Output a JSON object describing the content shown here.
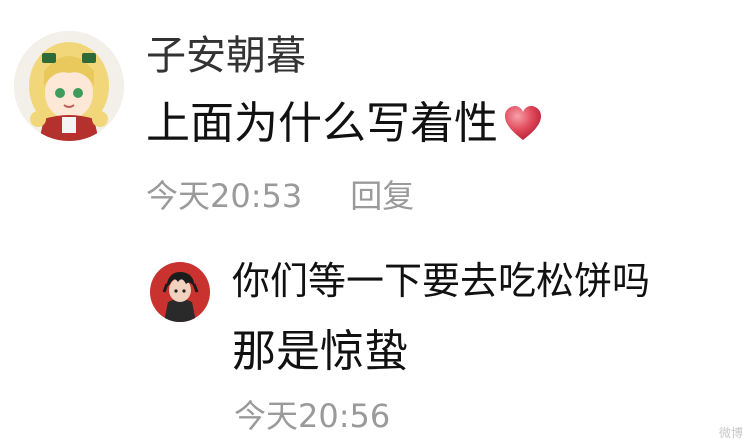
{
  "comment": {
    "username": "子安朝暮",
    "text": "上面为什么写着性",
    "emoji": "heart-icon",
    "time": "今天20:53",
    "reply_label": "回复"
  },
  "reply": {
    "username": "你们等一下要去吃松饼吗",
    "text": "那是惊蛰",
    "time": "今天20:56"
  },
  "watermark": "微博",
  "colors": {
    "text": "#111111",
    "meta": "#9a9a9a",
    "heart": "#e0475a"
  }
}
